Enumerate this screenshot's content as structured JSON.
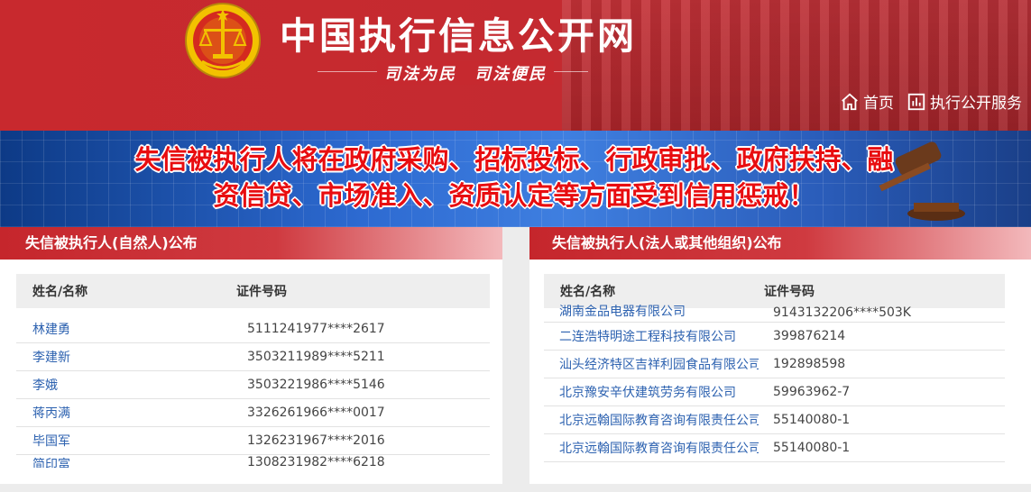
{
  "header": {
    "site_title": "中国执行信息公开网",
    "slogan": "司法为民　司法便民",
    "nav": [
      {
        "label": "首页",
        "icon": "home-icon"
      },
      {
        "label": "执行公开服务",
        "icon": "bar-chart-icon"
      }
    ]
  },
  "banner": {
    "line1": "失信被执行人将在政府采购、招标投标、行政审批、政府扶持、融",
    "line2": "资信贷、市场准入、资质认定等方面受到信用惩戒！"
  },
  "left_panel": {
    "title": "失信被执行人(自然人)公布",
    "columns": [
      "姓名/名称",
      "证件号码"
    ],
    "rows": [
      {
        "name": "林建勇",
        "id": "5111241977****2617"
      },
      {
        "name": "李建新",
        "id": "3503211989****5211"
      },
      {
        "name": "李娥",
        "id": "3503221986****5146"
      },
      {
        "name": "蒋丙满",
        "id": "3326261966****0017"
      },
      {
        "name": "毕国军",
        "id": "1326231967****2016"
      },
      {
        "name": "简印富",
        "id": "1308231982****6218"
      }
    ]
  },
  "right_panel": {
    "title": "失信被执行人(法人或其他组织)公布",
    "columns": [
      "姓名/名称",
      "证件号码"
    ],
    "rows": [
      {
        "name": "湖南金品电器有限公司",
        "id": "9143132206****503K"
      },
      {
        "name": "二连浩特明途工程科技有限公司",
        "id": "399876214"
      },
      {
        "name": "汕头经济特区吉祥利园食品有限公司",
        "id": "192898598"
      },
      {
        "name": "北京豫安辛伏建筑劳务有限公司",
        "id": "59963962-7"
      },
      {
        "name": "北京远翰国际教育咨询有限责任公司",
        "id": "55140080-1"
      },
      {
        "name": "北京远翰国际教育咨询有限责任公司",
        "id": "55140080-1"
      }
    ]
  },
  "colors": {
    "header_red": "#c8292e",
    "banner_blue": "#2d6ad1",
    "banner_text_red": "#e80d10",
    "link_blue": "#2d62b0"
  }
}
